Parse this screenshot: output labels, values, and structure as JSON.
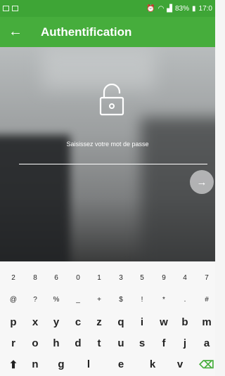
{
  "status_bar": {
    "battery": "83%",
    "time": "17:0"
  },
  "header": {
    "title": "Authentification"
  },
  "form": {
    "prompt": "Saisissez votre mot de passe"
  },
  "keyboard": {
    "numbers": [
      "2",
      "8",
      "6",
      "0",
      "1",
      "3",
      "5",
      "9",
      "4",
      "7"
    ],
    "symbols": [
      "@",
      "?",
      "%",
      "_",
      "+",
      "$",
      "!",
      "*",
      ".",
      "#"
    ],
    "row1": [
      "p",
      "x",
      "y",
      "c",
      "z",
      "q",
      "i",
      "w",
      "b",
      "m"
    ],
    "row2": [
      "r",
      "o",
      "h",
      "d",
      "t",
      "u",
      "s",
      "f",
      "j",
      "a"
    ],
    "row3": [
      "n",
      "g",
      "l",
      "e",
      "k",
      "v"
    ]
  },
  "colors": {
    "primary": "#46ad3c",
    "status_bar": "#3ea536",
    "backspace": "#46ad3c"
  },
  "icons": {
    "back": "arrow-back-icon",
    "lock": "lock-icon",
    "next": "arrow-forward-icon",
    "shift": "shift-icon",
    "backspace": "backspace-icon"
  }
}
